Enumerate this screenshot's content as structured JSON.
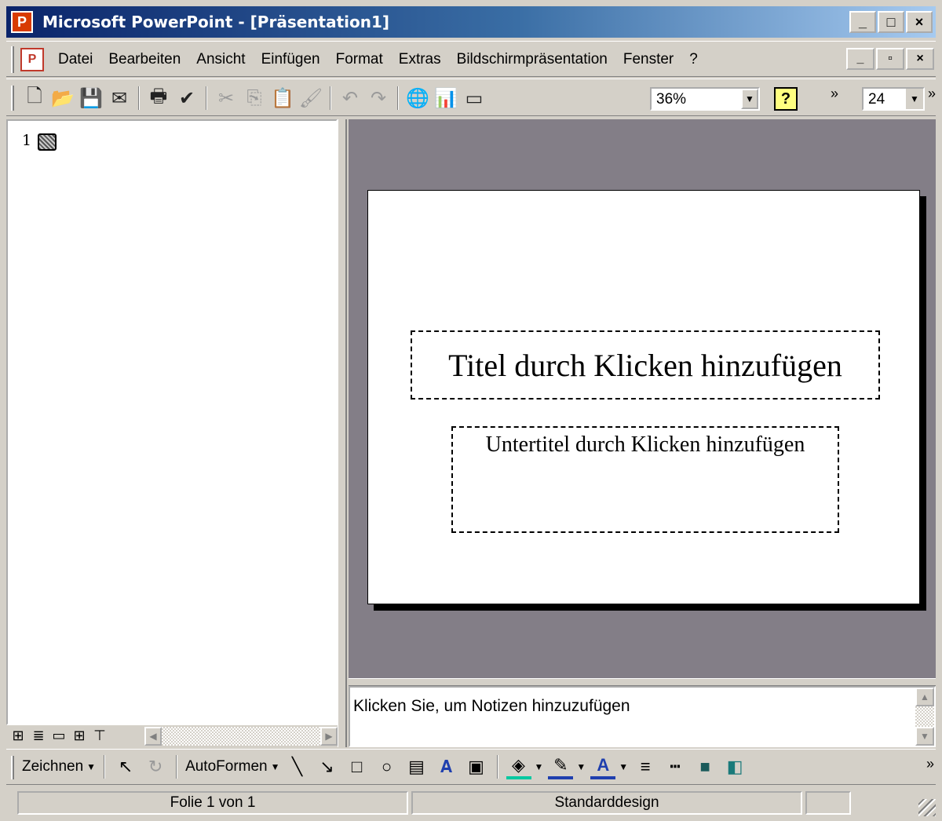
{
  "window": {
    "title": "Microsoft PowerPoint - [Präsentation1]",
    "app_icon": "powerpoint-icon",
    "controls": [
      "_",
      "□",
      "×"
    ]
  },
  "menubar": {
    "items": [
      "Datei",
      "Bearbeiten",
      "Ansicht",
      "Einfügen",
      "Format",
      "Extras",
      "Bildschirmpräsentation",
      "Fenster",
      "?"
    ],
    "doc_controls": [
      "_",
      "▫",
      "×"
    ]
  },
  "toolbar": {
    "icons": [
      "new-icon",
      "open-icon",
      "save-icon",
      "email-icon",
      "print-icon",
      "spelling-icon",
      "cut-icon",
      "copy-icon",
      "paste-icon",
      "format-painter-icon",
      "undo-icon",
      "redo-icon",
      "hyperlink-icon",
      "chart-icon",
      "new-slide-icon"
    ],
    "zoom": "36%",
    "font_size": "24"
  },
  "outline": {
    "slide_number": "1"
  },
  "slide": {
    "title_placeholder": "Titel durch Klicken hinzufügen",
    "subtitle_placeholder": "Untertitel durch Klicken hinzufügen"
  },
  "notes": {
    "placeholder": "Klicken Sie, um Notizen hinzuzufügen"
  },
  "drawbar": {
    "draw_label": "Zeichnen",
    "autoshapes_label": "AutoFormen"
  },
  "statusbar": {
    "slide_info": "Folie 1 von 1",
    "design": "Standarddesign"
  },
  "colors": {
    "titlebar_start": "#0a246a",
    "titlebar_end": "#a6caf0",
    "workspace": "#837e87",
    "chrome": "#d4d0c8"
  }
}
